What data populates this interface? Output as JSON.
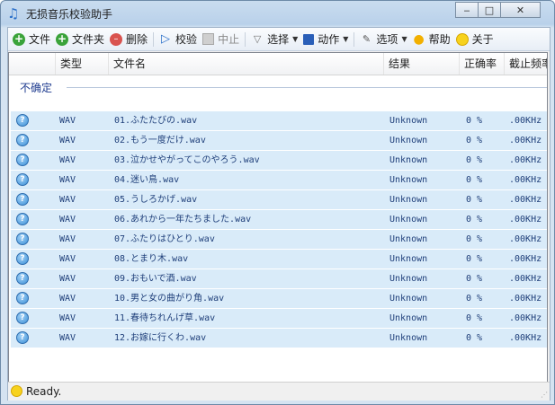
{
  "window": {
    "title": "无损音乐校验助手",
    "minimize": "‒",
    "maximize": "□",
    "close": "✕"
  },
  "toolbar": {
    "file": "文件",
    "folder": "文件夹",
    "delete": "删除",
    "verify": "校验",
    "stop": "中止",
    "select": "选择",
    "save": "动作",
    "options": "选项",
    "help": "帮助",
    "about": "关于"
  },
  "columns": [
    "类型",
    "文件名",
    "结果",
    "正确率",
    "截止频率"
  ],
  "group_label": "不确定",
  "rows": [
    {
      "type": "WAV",
      "name": "01.ふたたびの.wav",
      "result": "Unknown",
      "rate": "0 %",
      "freq": ".00KHz"
    },
    {
      "type": "WAV",
      "name": "02.もう一度だけ.wav",
      "result": "Unknown",
      "rate": "0 %",
      "freq": ".00KHz"
    },
    {
      "type": "WAV",
      "name": "03.泣かせやがってこのやろう.wav",
      "result": "Unknown",
      "rate": "0 %",
      "freq": ".00KHz"
    },
    {
      "type": "WAV",
      "name": "04.迷い鳥.wav",
      "result": "Unknown",
      "rate": "0 %",
      "freq": ".00KHz"
    },
    {
      "type": "WAV",
      "name": "05.うしろかげ.wav",
      "result": "Unknown",
      "rate": "0 %",
      "freq": ".00KHz"
    },
    {
      "type": "WAV",
      "name": "06.あれから一年たちました.wav",
      "result": "Unknown",
      "rate": "0 %",
      "freq": ".00KHz"
    },
    {
      "type": "WAV",
      "name": "07.ふたりはひとり.wav",
      "result": "Unknown",
      "rate": "0 %",
      "freq": ".00KHz"
    },
    {
      "type": "WAV",
      "name": "08.とまり木.wav",
      "result": "Unknown",
      "rate": "0 %",
      "freq": ".00KHz"
    },
    {
      "type": "WAV",
      "name": "09.おもいで酒.wav",
      "result": "Unknown",
      "rate": "0 %",
      "freq": ".00KHz"
    },
    {
      "type": "WAV",
      "name": "10.男と女の曲がり角.wav",
      "result": "Unknown",
      "rate": "0 %",
      "freq": ".00KHz"
    },
    {
      "type": "WAV",
      "name": "11.春待ちれんげ草.wav",
      "result": "Unknown",
      "rate": "0 %",
      "freq": ".00KHz"
    },
    {
      "type": "WAV",
      "name": "12.お嫁に行くわ.wav",
      "result": "Unknown",
      "rate": "0 %",
      "freq": ".00KHz"
    }
  ],
  "status": "Ready.",
  "colors": {
    "row_bg": "#d9ebf9",
    "row_text": "#1f3f7a",
    "group_text": "#1e3b8f"
  }
}
